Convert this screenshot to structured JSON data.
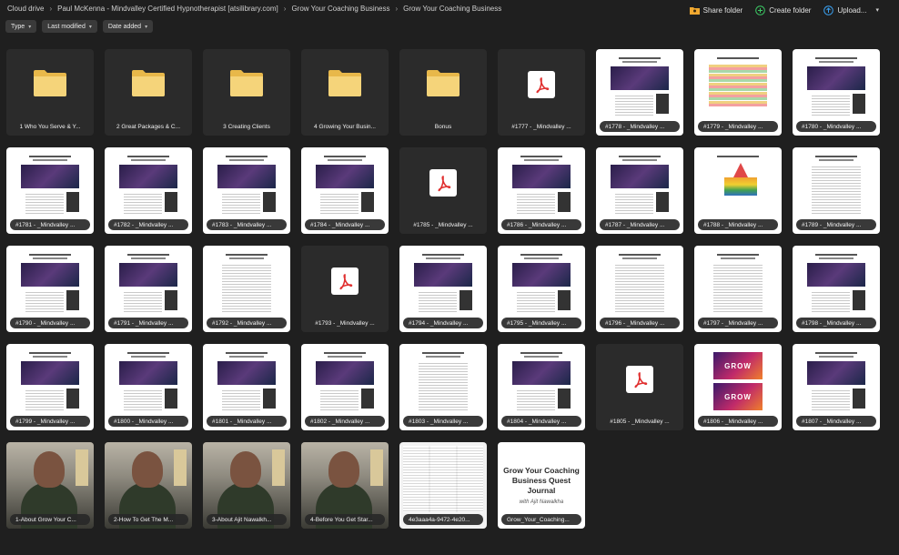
{
  "breadcrumbs": [
    "Cloud drive",
    "Paul McKenna - Mindvalley Certified Hypnotherapist [atsilibrary.com]",
    "Grow Your Coaching Business",
    "Grow Your Coaching Business"
  ],
  "actions": {
    "share": "Share folder",
    "create": "Create folder",
    "upload": "Upload..."
  },
  "filters": [
    "Type",
    "Last modified",
    "Date added"
  ],
  "colors": {
    "background": "#1f1f1f",
    "folder": "#f5d47a",
    "pdf_red": "#e03030",
    "create_green": "#3cc864",
    "upload_blue": "#3aa0f0"
  },
  "items": [
    {
      "label": "1 Who You Serve & Y...",
      "kind": "folder"
    },
    {
      "label": "2 Great Packages & C...",
      "kind": "folder"
    },
    {
      "label": "3 Creating Clients",
      "kind": "folder"
    },
    {
      "label": "4 Growing Your Busin...",
      "kind": "folder"
    },
    {
      "label": "Bonus",
      "kind": "folder"
    },
    {
      "label": "#1777 - _Mindvalley ...",
      "kind": "pdf"
    },
    {
      "label": "#1778 - _Mindvalley ...",
      "kind": "doc"
    },
    {
      "label": "#1779 - _Mindvalley ...",
      "kind": "doc"
    },
    {
      "label": "#1780 - _Mindvalley ...",
      "kind": "doc"
    },
    {
      "label": "#1781 - _Mindvalley ...",
      "kind": "doc"
    },
    {
      "label": "#1782 - _Mindvalley ...",
      "kind": "doc"
    },
    {
      "label": "#1783 - _Mindvalley ...",
      "kind": "doc"
    },
    {
      "label": "#1784 - _Mindvalley ...",
      "kind": "doc"
    },
    {
      "label": "#1785 - _Mindvalley ...",
      "kind": "pdf"
    },
    {
      "label": "#1786 - _Mindvalley ...",
      "kind": "doc"
    },
    {
      "label": "#1787 - _Mindvalley ...",
      "kind": "doc"
    },
    {
      "label": "#1788 - _Mindvalley ...",
      "kind": "doc"
    },
    {
      "label": "#1789 - _Mindvalley ...",
      "kind": "doc"
    },
    {
      "label": "#1790 - _Mindvalley ...",
      "kind": "doc"
    },
    {
      "label": "#1791 - _Mindvalley ...",
      "kind": "doc"
    },
    {
      "label": "#1792 - _Mindvalley ...",
      "kind": "doc"
    },
    {
      "label": "#1793 - _Mindvalley ...",
      "kind": "pdf"
    },
    {
      "label": "#1794 - _Mindvalley ...",
      "kind": "doc"
    },
    {
      "label": "#1795 - _Mindvalley ...",
      "kind": "doc"
    },
    {
      "label": "#1796 - _Mindvalley ...",
      "kind": "doc"
    },
    {
      "label": "#1797 - _Mindvalley ...",
      "kind": "doc"
    },
    {
      "label": "#1798 - _Mindvalley ...",
      "kind": "doc"
    },
    {
      "label": "#1799 - _Mindvalley ...",
      "kind": "doc"
    },
    {
      "label": "#1800 - _Mindvalley ...",
      "kind": "doc"
    },
    {
      "label": "#1801 - _Mindvalley ...",
      "kind": "doc"
    },
    {
      "label": "#1802 - _Mindvalley ...",
      "kind": "doc"
    },
    {
      "label": "#1803 - _Mindvalley ...",
      "kind": "doc"
    },
    {
      "label": "#1804 - _Mindvalley ...",
      "kind": "doc"
    },
    {
      "label": "#1805 - _Mindvalley ...",
      "kind": "pdf"
    },
    {
      "label": "#1806 - _Mindvalley ...",
      "kind": "doc"
    },
    {
      "label": "#1807 - _Mindvalley ...",
      "kind": "doc"
    },
    {
      "label": "1-About Grow Your C...",
      "kind": "video"
    },
    {
      "label": "2-How To Get The M...",
      "kind": "video"
    },
    {
      "label": "3-About Ajit Nawalkh...",
      "kind": "video"
    },
    {
      "label": "4-Before You Get Star...",
      "kind": "video"
    },
    {
      "label": "4e3aaa4a-9472-4e20...",
      "kind": "scan"
    },
    {
      "label": "Grow_Your_Coaching...",
      "kind": "quest"
    }
  ],
  "quest": {
    "title": "Grow Your Coaching Business Quest Journal",
    "subtitle": "with Ajit Nawalkha"
  }
}
